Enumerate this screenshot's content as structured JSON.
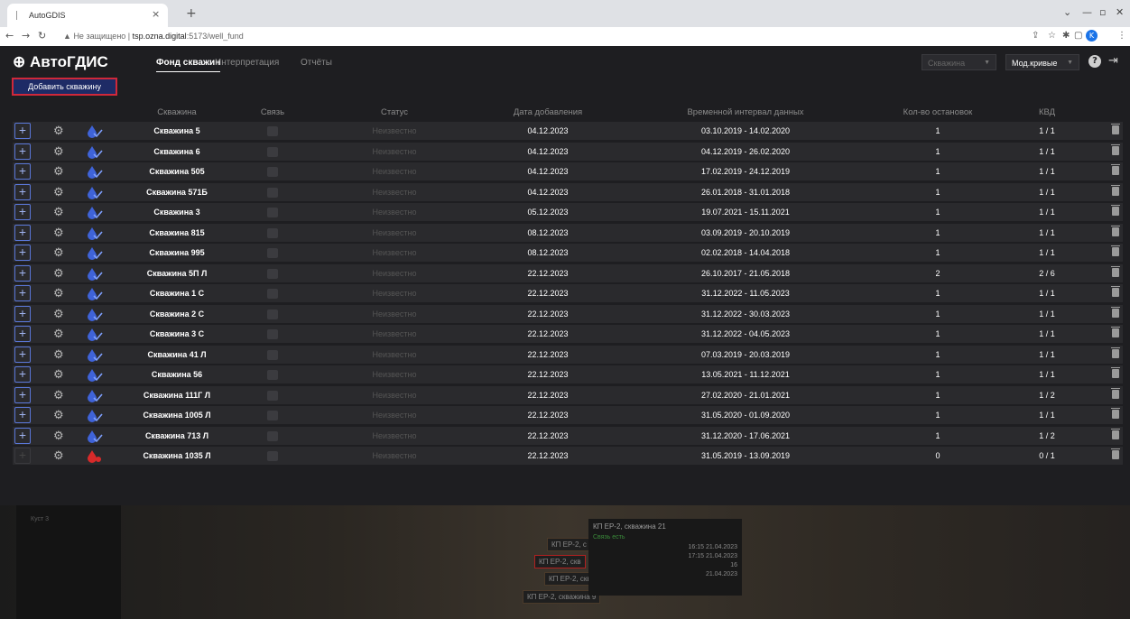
{
  "browser": {
    "tab_title": "AutoGDIS",
    "tab_close": "×",
    "new_tab": "+",
    "security": "Не защищено",
    "url_host": "tsp.ozna.digital",
    "url_path": ":5173/well_fund",
    "avatar_letter": "K"
  },
  "app": {
    "logo": "АвтоГДИС",
    "nav": [
      "Фонд скважин",
      "Интерпретация",
      "Отчёты"
    ],
    "well_select": "Скважина",
    "model_select": "Мод.кривые",
    "add_button": "Добавить скважину"
  },
  "table": {
    "columns": [
      "Скважина",
      "Связь",
      "Статус",
      "Дата добавления",
      "Временной интервал данных",
      "Кол-во остановок",
      "КВД"
    ],
    "rows": [
      {
        "name": "Скважина 5",
        "status": "Неизвестно",
        "date": "04.12.2023",
        "interval": "03.10.2019 - 14.02.2020",
        "stops": "1",
        "kvd": "1 / 1",
        "enabled": true
      },
      {
        "name": "Скважина 6",
        "status": "Неизвестно",
        "date": "04.12.2023",
        "interval": "04.12.2019 - 26.02.2020",
        "stops": "1",
        "kvd": "1 / 1",
        "enabled": true
      },
      {
        "name": "Скважина 505",
        "status": "Неизвестно",
        "date": "04.12.2023",
        "interval": "17.02.2019 - 24.12.2019",
        "stops": "1",
        "kvd": "1 / 1",
        "enabled": true
      },
      {
        "name": "Скважина 571Б",
        "status": "Неизвестно",
        "date": "04.12.2023",
        "interval": "26.01.2018 - 31.01.2018",
        "stops": "1",
        "kvd": "1 / 1",
        "enabled": true
      },
      {
        "name": "Скважина 3",
        "status": "Неизвестно",
        "date": "05.12.2023",
        "interval": "19.07.2021 - 15.11.2021",
        "stops": "1",
        "kvd": "1 / 1",
        "enabled": true
      },
      {
        "name": "Скважина 815",
        "status": "Неизвестно",
        "date": "08.12.2023",
        "interval": "03.09.2019 - 20.10.2019",
        "stops": "1",
        "kvd": "1 / 1",
        "enabled": true
      },
      {
        "name": "Скважина 995",
        "status": "Неизвестно",
        "date": "08.12.2023",
        "interval": "02.02.2018 - 14.04.2018",
        "stops": "1",
        "kvd": "1 / 1",
        "enabled": true
      },
      {
        "name": "Скважина 5П Л",
        "status": "Неизвестно",
        "date": "22.12.2023",
        "interval": "26.10.2017 - 21.05.2018",
        "stops": "2",
        "kvd": "2 / 6",
        "enabled": true
      },
      {
        "name": "Скважина 1 С",
        "status": "Неизвестно",
        "date": "22.12.2023",
        "interval": "31.12.2022 - 11.05.2023",
        "stops": "1",
        "kvd": "1 / 1",
        "enabled": true
      },
      {
        "name": "Скважина 2 С",
        "status": "Неизвестно",
        "date": "22.12.2023",
        "interval": "31.12.2022 - 30.03.2023",
        "stops": "1",
        "kvd": "1 / 1",
        "enabled": true
      },
      {
        "name": "Скважина 3 С",
        "status": "Неизвестно",
        "date": "22.12.2023",
        "interval": "31.12.2022 - 04.05.2023",
        "stops": "1",
        "kvd": "1 / 1",
        "enabled": true
      },
      {
        "name": "Скважина 41 Л",
        "status": "Неизвестно",
        "date": "22.12.2023",
        "interval": "07.03.2019 - 20.03.2019",
        "stops": "1",
        "kvd": "1 / 1",
        "enabled": true
      },
      {
        "name": "Скважина 56",
        "status": "Неизвестно",
        "date": "22.12.2023",
        "interval": "13.05.2021 - 11.12.2021",
        "stops": "1",
        "kvd": "1 / 1",
        "enabled": true
      },
      {
        "name": "Скважина 111Г Л",
        "status": "Неизвестно",
        "date": "22.12.2023",
        "interval": "27.02.2020 - 21.01.2021",
        "stops": "1",
        "kvd": "1 / 2",
        "enabled": true
      },
      {
        "name": "Скважина 1005 Л",
        "status": "Неизвестно",
        "date": "22.12.2023",
        "interval": "31.05.2020 - 01.09.2020",
        "stops": "1",
        "kvd": "1 / 1",
        "enabled": true
      },
      {
        "name": "Скважина 713 Л",
        "status": "Неизвестно",
        "date": "22.12.2023",
        "interval": "31.12.2020 - 17.06.2021",
        "stops": "1",
        "kvd": "1 / 2",
        "enabled": true
      },
      {
        "name": "Скважина 1035 Л",
        "status": "Неизвестно",
        "date": "22.12.2023",
        "interval": "31.05.2019 - 13.09.2019",
        "stops": "0",
        "kvd": "0 / 1",
        "enabled": false
      }
    ]
  },
  "map": {
    "tree_root": "Куст 3",
    "labels": [
      "КП ЕР-2, с",
      "КП ЕР-2, скв",
      "КП ЕР-2, скв",
      "КП ЕР-2, скважина 9"
    ],
    "popup_title": "КП ЕР-2, скважина 21",
    "popup_status": "Связь есть",
    "popup_values": [
      "16:15 21.04.2023",
      "17:15 21.04.2023",
      "16",
      "21.04.2023"
    ]
  },
  "colors": {
    "accent_blue": "#1e2b66",
    "highlight_red": "#d0283a",
    "drop_blue": "#3f63d8",
    "drop_red": "#d82a2a"
  }
}
